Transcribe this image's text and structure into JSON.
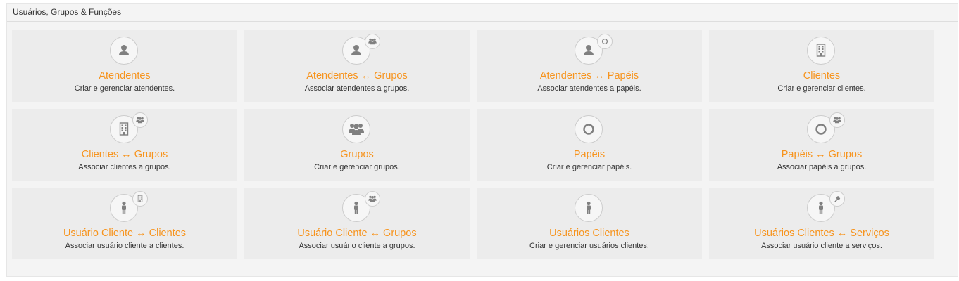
{
  "panel": {
    "title": "Usuários, Grupos & Funções"
  },
  "colors": {
    "accent": "#f7941e",
    "icon": "#808080",
    "tile_bg": "#ececec"
  },
  "tiles": [
    {
      "title": "Atendentes",
      "description": "Criar e gerenciar atendentes.",
      "icon": "person-icon",
      "badge": null
    },
    {
      "title": "Atendentes ↔ Grupos",
      "description": "Associar atendentes a grupos.",
      "icon": "person-icon",
      "badge": "group-icon"
    },
    {
      "title": "Atendentes ↔ Papéis",
      "description": "Associar atendentes a papéis.",
      "icon": "person-icon",
      "badge": "role-circle-icon"
    },
    {
      "title": "Clientes",
      "description": "Criar e gerenciar clientes.",
      "icon": "building-icon",
      "badge": null
    },
    {
      "title": "Clientes ↔ Grupos",
      "description": "Associar clientes a grupos.",
      "icon": "building-icon",
      "badge": "group-icon"
    },
    {
      "title": "Grupos",
      "description": "Criar e gerenciar grupos.",
      "icon": "group-icon",
      "badge": null
    },
    {
      "title": "Papéis",
      "description": "Criar e gerenciar papéis.",
      "icon": "role-circle-icon",
      "badge": null
    },
    {
      "title": "Papéis ↔ Grupos",
      "description": "Associar papéis a grupos.",
      "icon": "role-circle-icon",
      "badge": "group-icon"
    },
    {
      "title": "Usuário Cliente ↔ Clientes",
      "description": "Associar usuário cliente a clientes.",
      "icon": "customer-user-icon",
      "badge": "building-icon"
    },
    {
      "title": "Usuário Cliente ↔ Grupos",
      "description": "Associar usuário cliente a grupos.",
      "icon": "customer-user-icon",
      "badge": "group-icon"
    },
    {
      "title": "Usuários Clientes",
      "description": "Criar e gerenciar usuários clientes.",
      "icon": "customer-user-icon",
      "badge": null
    },
    {
      "title": "Usuários Clientes ↔ Serviços",
      "description": "Associar usuário cliente a serviços.",
      "icon": "customer-user-icon",
      "badge": "wrench-icon"
    }
  ]
}
